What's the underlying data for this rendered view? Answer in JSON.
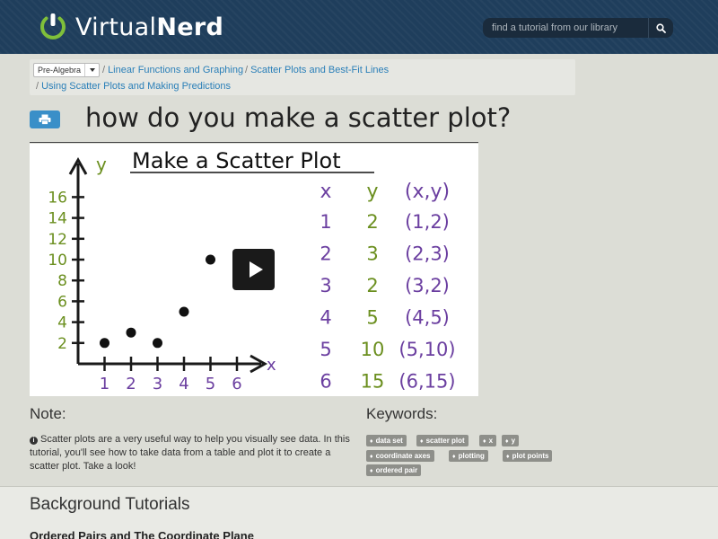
{
  "header": {
    "logo_light": "Virtual",
    "logo_bold": "Nerd",
    "search_placeholder": "find a tutorial from our library",
    "icons": {
      "logo": "power-icon",
      "search": "search-icon"
    }
  },
  "breadcrumb": {
    "subject": "Pre-Algebra",
    "items": [
      "Linear Functions and Graphing",
      "Scatter Plots and Best-Fit Lines",
      "Using Scatter Plots and Making Predictions"
    ]
  },
  "page": {
    "title": "how do you make a scatter plot?",
    "print_icon": "print-icon"
  },
  "video": {
    "heading": "Make a Scatter Plot",
    "play_icon": "play-icon",
    "axis_y_label": "y",
    "axis_x_label": "x",
    "y_ticks": [
      "16",
      "14",
      "12",
      "10",
      "8",
      "6",
      "4",
      "2"
    ],
    "x_ticks": [
      "1",
      "2",
      "3",
      "4",
      "5",
      "6"
    ],
    "points": [
      {
        "x": 1,
        "y": 2
      },
      {
        "x": 2,
        "y": 3
      },
      {
        "x": 3,
        "y": 2
      },
      {
        "x": 4,
        "y": 5
      },
      {
        "x": 5,
        "y": 10
      }
    ],
    "table": {
      "headers": [
        "x",
        "y",
        "(x,y)"
      ],
      "rows": [
        [
          "1",
          "2",
          "(1,2)"
        ],
        [
          "2",
          "3",
          "(2,3)"
        ],
        [
          "3",
          "2",
          "(3,2)"
        ],
        [
          "4",
          "5",
          "(4,5)"
        ],
        [
          "5",
          "10",
          "(5,10)"
        ],
        [
          "6",
          "15",
          "(6,15)"
        ]
      ]
    },
    "colors": {
      "x_col": "#6b3fa0",
      "y_col": "#6b8f1f",
      "pair_col": "#6b3fa0"
    }
  },
  "note": {
    "heading": "Note:",
    "text": "Scatter plots are a very useful way to help you visually see data. In this tutorial, you'll see how to take data from a table and plot it to create a scatter plot. Take a look!"
  },
  "keywords": {
    "heading": "Keywords:",
    "tags": [
      "data set",
      "scatter plot",
      "x",
      "y",
      "coordinate axes",
      "plotting",
      "plot points",
      "ordered pair"
    ]
  },
  "background": {
    "heading": "Background Tutorials",
    "items": [
      "Ordered Pairs and The Coordinate Plane"
    ]
  }
}
